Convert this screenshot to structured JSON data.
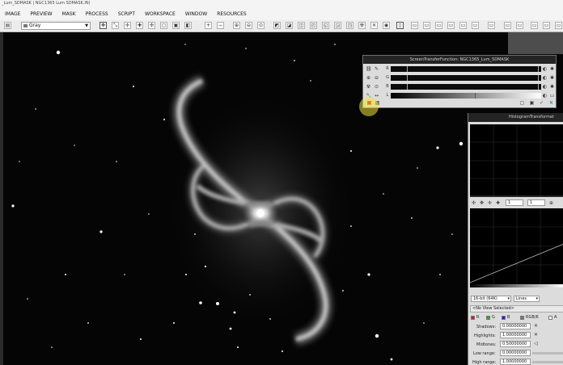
{
  "window": {
    "title": "_Lum_SDMASK | NGC1365 Lum SDMASK.IN)"
  },
  "menu": [
    "IMAGE",
    "PREVIEW",
    "MASK",
    "PROCESS",
    "SCRIPT",
    "WORKSPACE",
    "WINDOW",
    "RESOURCES"
  ],
  "toolbar": {
    "view_mode": "Gray"
  },
  "stf": {
    "title": "ScreenTransferFunction: NGC1365_Lum_SDMASK",
    "channels": [
      "R",
      "G",
      "B",
      "L"
    ]
  },
  "histogram": {
    "title": "HistogramTransformat",
    "zoom_x": "1",
    "zoom_y": "1",
    "bit_depth": "16-bit (64K)",
    "graph_style": "Lines",
    "view_selected": "<No View Selected>",
    "channels": [
      "R",
      "G",
      "B",
      "RGB/K",
      "A"
    ],
    "shadows_label": "Shadows:",
    "shadows": "0.00000000",
    "highlights_label": "Highlights:",
    "highlights": "1.00000000",
    "midtones_label": "Midtones:",
    "midtones": "0.50000000",
    "low_range_label": "Low range:",
    "low_range": "0.00000000",
    "high_range_label": "High range:",
    "high_range": "1.00000000"
  }
}
